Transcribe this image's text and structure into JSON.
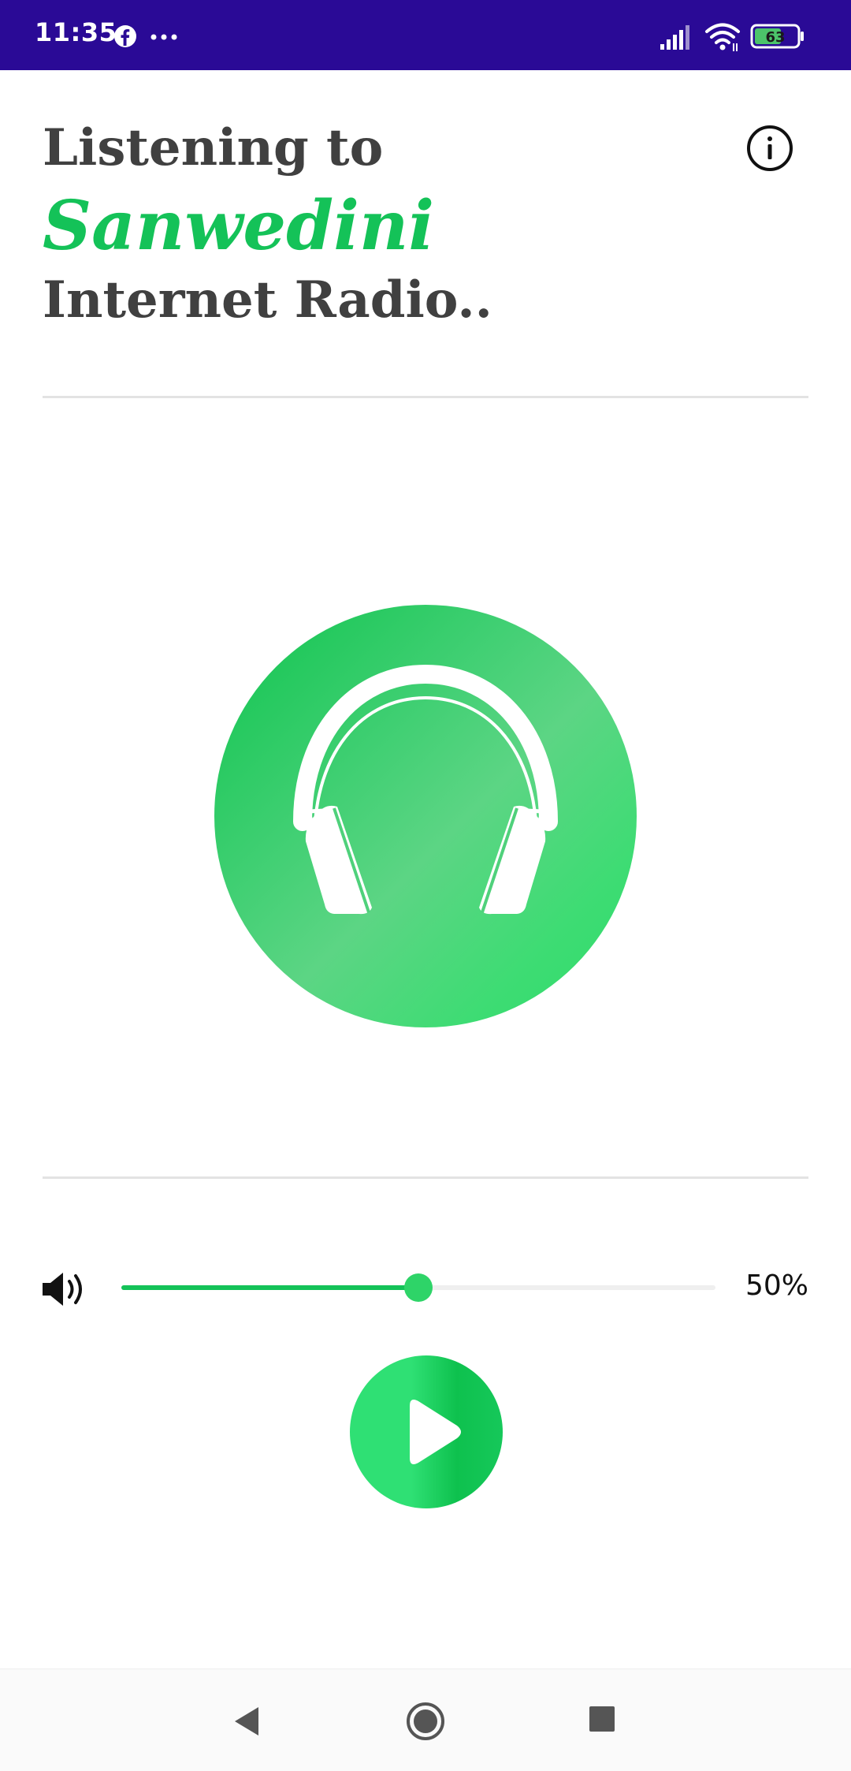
{
  "status_bar": {
    "time": "11:35",
    "battery_level": "63",
    "icons": [
      "facebook-icon",
      "more-dots-icon",
      "signal-icon",
      "wifi-icon",
      "battery-icon"
    ],
    "background_color": "#2a0a96"
  },
  "header": {
    "line1": "Listening to",
    "station_name": "Sanwedini",
    "line3": "Internet Radio..",
    "info_icon": "info-icon",
    "accent_color": "#14c258"
  },
  "artwork": {
    "icon": "headphones-icon"
  },
  "volume": {
    "icon": "volume-icon",
    "level": 0.5,
    "value_text": "50%"
  },
  "player": {
    "play_icon": "play-icon"
  },
  "nav_bar": {
    "buttons": [
      "back-icon",
      "home-icon",
      "recents-icon"
    ]
  }
}
